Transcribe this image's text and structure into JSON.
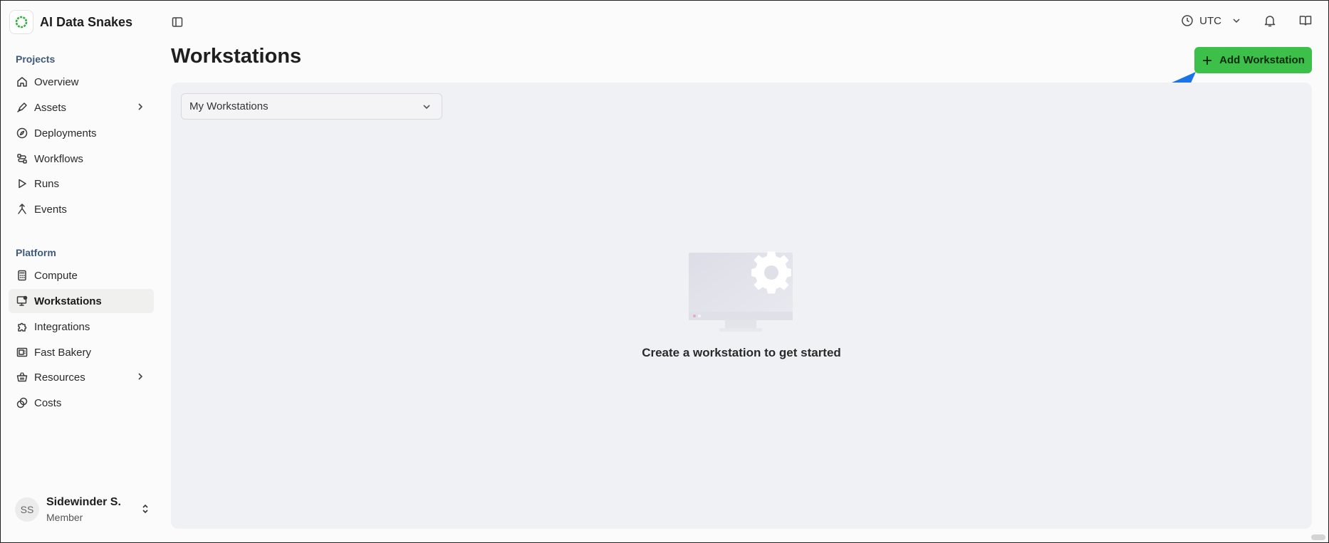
{
  "brand": {
    "name": "AI Data Snakes",
    "icon": "circle-ring-logo"
  },
  "sidebar": {
    "sections": [
      {
        "label": "Projects",
        "items": [
          {
            "label": "Overview",
            "icon": "home-icon"
          },
          {
            "label": "Assets",
            "icon": "pen-icon",
            "has_submenu": true
          },
          {
            "label": "Deployments",
            "icon": "compass-icon"
          },
          {
            "label": "Workflows",
            "icon": "workflow-icon"
          },
          {
            "label": "Runs",
            "icon": "play-icon"
          },
          {
            "label": "Events",
            "icon": "merge-icon"
          }
        ]
      },
      {
        "label": "Platform",
        "items": [
          {
            "label": "Compute",
            "icon": "calculator-icon"
          },
          {
            "label": "Workstations",
            "icon": "monitor-gear-icon",
            "active": true
          },
          {
            "label": "Integrations",
            "icon": "puzzle-icon"
          },
          {
            "label": "Fast Bakery",
            "icon": "oven-icon"
          },
          {
            "label": "Resources",
            "icon": "basket-icon",
            "has_submenu": true
          },
          {
            "label": "Costs",
            "icon": "coins-icon"
          }
        ]
      }
    ]
  },
  "user": {
    "initials": "SS",
    "name": "Sidewinder S.",
    "role": "Member"
  },
  "topbar": {
    "timezone": "UTC"
  },
  "page": {
    "title": "Workstations",
    "add_button_label": "Add Workstation",
    "filter_selected": "My Workstations",
    "empty_message": "Create a workstation to get started"
  },
  "colors": {
    "accent_green": "#3cc04a",
    "annotation_arrow": "#1a73e8",
    "panel_bg": "#f0f1f5"
  }
}
